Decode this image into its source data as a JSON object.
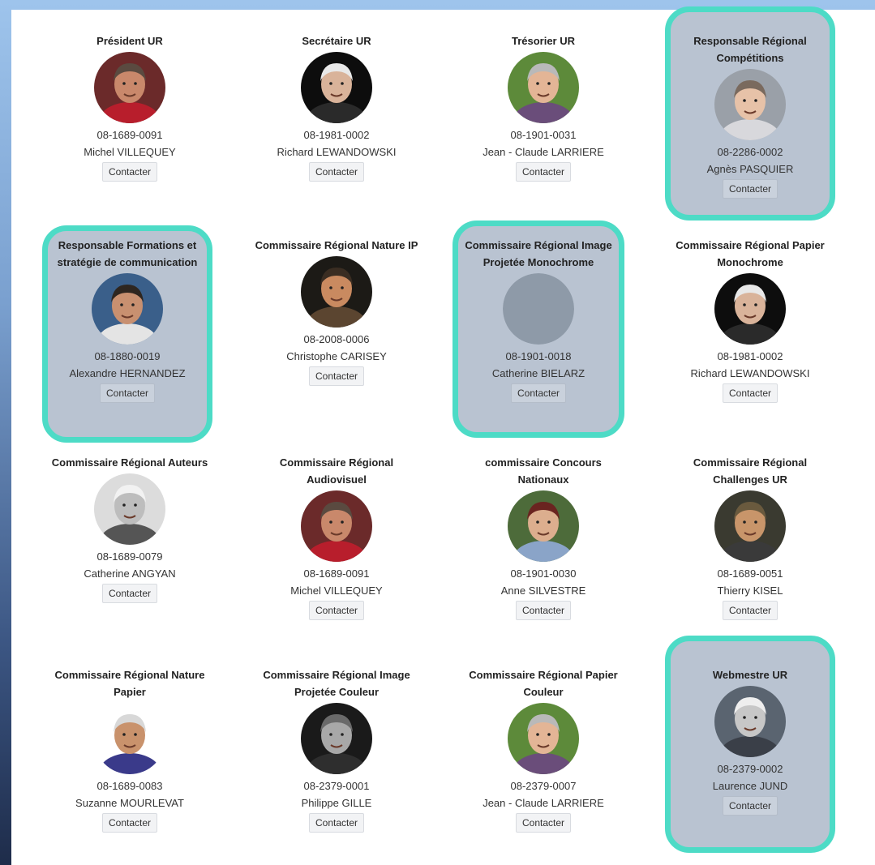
{
  "button_label": "Contacter",
  "colors": {
    "highlight_border": "#4ddbc6",
    "highlight_bg": "#b9c3d1"
  },
  "members": [
    {
      "role": "Président UR",
      "license": "08-1689-0091",
      "name": "Michel VILLEQUEY",
      "highlight": false,
      "avatar": "a"
    },
    {
      "role": "Secrétaire UR",
      "license": "08-1981-0002",
      "name": "Richard LEWANDOWSKI",
      "highlight": false,
      "avatar": "b"
    },
    {
      "role": "Trésorier UR",
      "license": "08-1901-0031",
      "name": "Jean - Claude LARRIERE",
      "highlight": false,
      "avatar": "c"
    },
    {
      "role": "Responsable Régional Compétitions",
      "license": "08-2286-0002",
      "name": "Agnès PASQUIER",
      "highlight": true,
      "avatar": "d"
    },
    {
      "role": "Responsable Formations et stratégie de communication",
      "license": "08-1880-0019",
      "name": "Alexandre HERNANDEZ",
      "highlight": true,
      "avatar": "e"
    },
    {
      "role": "Commissaire Régional Nature IP",
      "license": "08-2008-0006",
      "name": "Christophe CARISEY",
      "highlight": false,
      "avatar": "f"
    },
    {
      "role": "Commissaire Régional Image Projetée Monochrome",
      "license": "08-1901-0018",
      "name": "Catherine BIELARZ",
      "highlight": true,
      "avatar": "none"
    },
    {
      "role": "Commissaire Régional Papier Monochrome",
      "license": "08-1981-0002",
      "name": "Richard LEWANDOWSKI",
      "highlight": false,
      "avatar": "b"
    },
    {
      "role": "Commissaire Régional Auteurs",
      "license": "08-1689-0079",
      "name": "Catherine ANGYAN",
      "highlight": false,
      "avatar": "g"
    },
    {
      "role": "Commissaire Régional Audiovisuel",
      "license": "08-1689-0091",
      "name": "Michel VILLEQUEY",
      "highlight": false,
      "avatar": "a"
    },
    {
      "role": "commissaire Concours Nationaux",
      "license": "08-1901-0030",
      "name": "Anne SILVESTRE",
      "highlight": false,
      "avatar": "h"
    },
    {
      "role": "Commissaire Régional Challenges UR",
      "license": "08-1689-0051",
      "name": "Thierry KISEL",
      "highlight": false,
      "avatar": "i"
    },
    {
      "role": "Commissaire Régional Nature Papier",
      "license": "08-1689-0083",
      "name": "Suzanne MOURLEVAT",
      "highlight": false,
      "avatar": "j"
    },
    {
      "role": "Commissaire Régional Image Projetée Couleur",
      "license": "08-2379-0001",
      "name": "Philippe GILLE",
      "highlight": false,
      "avatar": "k"
    },
    {
      "role": "Commissaire Régional Papier Couleur",
      "license": "08-2379-0007",
      "name": "Jean - Claude LARRIERE",
      "highlight": false,
      "avatar": "c"
    },
    {
      "role": "Webmestre UR",
      "license": "08-2379-0002",
      "name": "Laurence JUND",
      "highlight": true,
      "avatar": "l"
    }
  ]
}
